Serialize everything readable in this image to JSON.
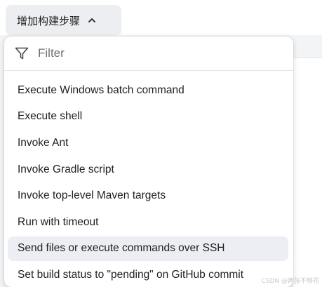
{
  "trigger": {
    "label": "增加构建步骤",
    "icon": "chevron-up-icon"
  },
  "filter": {
    "placeholder": "Filter",
    "value": "",
    "icon": "filter-funnel-icon"
  },
  "menu": {
    "items": [
      {
        "label": "Execute Windows batch command"
      },
      {
        "label": "Execute shell"
      },
      {
        "label": "Invoke Ant"
      },
      {
        "label": "Invoke Gradle script"
      },
      {
        "label": "Invoke top-level Maven targets"
      },
      {
        "label": "Run with timeout"
      },
      {
        "label": "Send files or execute commands over SSH",
        "hovered": true
      },
      {
        "label": "Set build status to \"pending\" on GitHub commit"
      }
    ]
  },
  "watermark": {
    "text": "CSDN @两张不够花"
  },
  "colors": {
    "hover_bg": "#eceef3",
    "trigger_bg": "#eceef1",
    "page_bg": "#f3f4f6"
  }
}
